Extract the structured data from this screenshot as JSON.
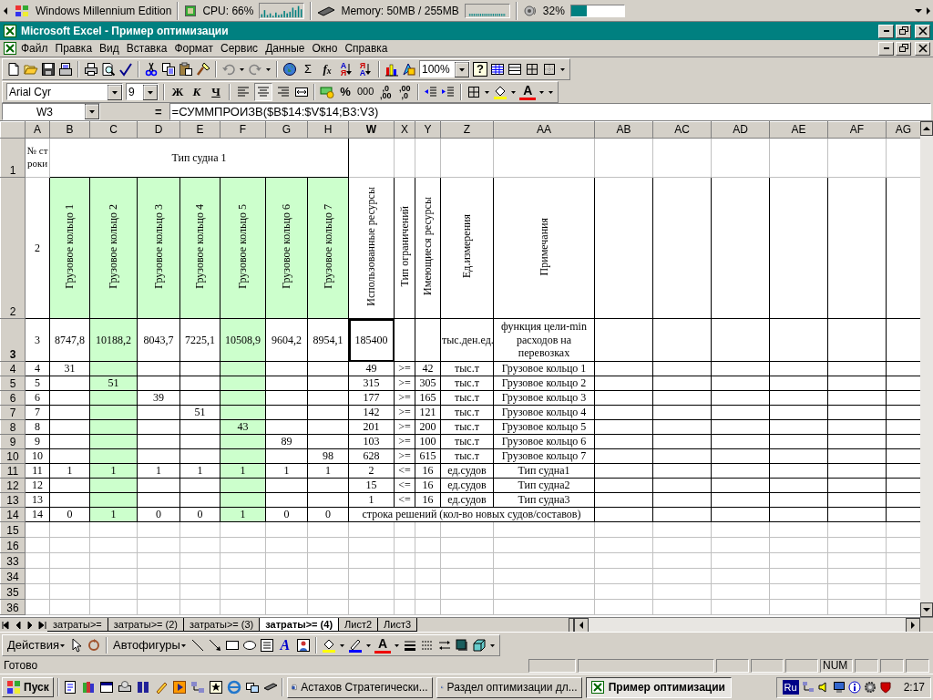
{
  "system_bar": {
    "os_label": "Windows Millennium Edition",
    "cpu": "CPU: 66%",
    "memory": "Memory: 50MB / 255MB",
    "volume": {
      "reading": "32%",
      "level": 0.3
    }
  },
  "window": {
    "title": "Microsoft Excel - Пример оптимизации"
  },
  "menu": [
    "Файл",
    "Правка",
    "Вид",
    "Вставка",
    "Формат",
    "Сервис",
    "Данные",
    "Окно",
    "Справка"
  ],
  "standard_toolbar": {
    "sum": "Σ",
    "function": "f$_{x}$",
    "sort_ascending": [
      "А",
      "Я"
    ],
    "sort_descending": [
      "Я",
      "А"
    ],
    "zoom": "100%",
    "help": "?"
  },
  "formatting_toolbar": {
    "font": "Arial Cyr",
    "size": "9",
    "bold": "Ж",
    "italic": "К",
    "underline": "Ч",
    "alignment": [
      {
        "selected": false
      },
      {
        "selected": true
      },
      {
        "selected": false
      }
    ],
    "percent": "%",
    "thousands": "000",
    "increase_decimal": [
      ",0",
      ",00"
    ],
    "decrease_decimal": [
      ",00",
      ",0"
    ],
    "font_color": "A"
  },
  "formula_bar": {
    "name_box": "W3",
    "equals": "=",
    "formula": "=СУММПРОИЗВ($B$14:$V$14;B3:V3)"
  },
  "columns": [
    {
      "label": "A",
      "selected": false
    },
    {
      "label": "B",
      "selected": false
    },
    {
      "label": "C",
      "selected": false
    },
    {
      "label": "D",
      "selected": false
    },
    {
      "label": "E",
      "selected": false
    },
    {
      "label": "F",
      "selected": false
    },
    {
      "label": "G",
      "selected": false
    },
    {
      "label": "H",
      "selected": false
    },
    {
      "label": "W",
      "selected": true
    },
    {
      "label": "X",
      "selected": false
    },
    {
      "label": "Y",
      "selected": false
    },
    {
      "label": "Z",
      "selected": false
    },
    {
      "label": "AA",
      "selected": false
    },
    {
      "label": "AB",
      "selected": false
    },
    {
      "label": "AC",
      "selected": false
    },
    {
      "label": "AD",
      "selected": false
    },
    {
      "label": "AE",
      "selected": false
    },
    {
      "label": "AF",
      "selected": false
    },
    {
      "label": "AG",
      "selected": false
    }
  ],
  "rows": [
    {
      "label": "1",
      "selected": false,
      "boxed": false,
      "cells": [
        {
          "text": "№ строки"
        },
        {
          "text": "Тип судна 1"
        },
        {
          "kind": "continued"
        },
        {
          "kind": "continued"
        },
        {
          "kind": "continued"
        },
        {
          "kind": "continued"
        },
        {
          "kind": "continued"
        },
        {
          "kind": "continued"
        }
      ]
    },
    {
      "label": "2",
      "selected": false,
      "boxed": true,
      "cells": [
        {
          "text": "2"
        },
        {
          "text": "Грузовое кольцо 1",
          "kind": "vertical",
          "color": "#ccffcc"
        },
        {
          "text": "Грузовое кольцо 2",
          "kind": "vertical",
          "color": "#ccffcc"
        },
        {
          "text": "Грузовое кольцо 3",
          "kind": "vertical",
          "color": "#ccffcc"
        },
        {
          "text": "Грузовое кольцо 4",
          "kind": "vertical",
          "color": "#ccffcc"
        },
        {
          "text": "Грузовое кольцо 5",
          "kind": "vertical",
          "color": "#ccffcc"
        },
        {
          "text": "Грузовое кольцо 6",
          "kind": "vertical",
          "color": "#ccffcc"
        },
        {
          "text": "Грузовое кольцо 7",
          "kind": "vertical",
          "color": "#ccffcc"
        },
        {
          "text": "Использованные ресурсы",
          "kind": "vertical"
        },
        {
          "text": "Тип ограничений",
          "kind": "vertical"
        },
        {
          "text": "Имеющиеся ресурсы",
          "kind": "vertical"
        },
        {
          "text": "Ед.измерения",
          "kind": "vertical"
        },
        {
          "text": "Примечания",
          "kind": "vertical"
        }
      ]
    },
    {
      "label": "3",
      "selected": true,
      "boxed": true,
      "cells": [
        {
          "text": "3"
        },
        {
          "text": "8747,8"
        },
        {
          "text": "10188,2",
          "color": "#ccffcc"
        },
        {
          "text": "8043,7"
        },
        {
          "text": "7225,1"
        },
        {
          "text": "10508,9",
          "color": "#ccffcc"
        },
        {
          "text": "9604,2"
        },
        {
          "text": "8954,1"
        },
        {
          "text": "185400"
        },
        null,
        null,
        {
          "text": "тыс.ден.ед."
        },
        {
          "text": "функция цели-min расходов на перевозках"
        }
      ]
    },
    {
      "label": "4",
      "selected": false,
      "boxed": true,
      "cells": [
        {
          "text": "4"
        },
        {
          "text": "31"
        },
        {
          "color": "#ccffcc"
        },
        null,
        null,
        {
          "color": "#ccffcc"
        },
        null,
        null,
        {
          "text": "49"
        },
        {
          "text": ">="
        },
        {
          "text": "42"
        },
        {
          "text": "тыс.т"
        },
        {
          "text": "Грузовое кольцо 1"
        }
      ]
    },
    {
      "label": "5",
      "selected": false,
      "boxed": true,
      "cells": [
        {
          "text": "5"
        },
        null,
        {
          "text": "51",
          "color": "#ccffcc"
        },
        null,
        null,
        {
          "color": "#ccffcc"
        },
        null,
        null,
        {
          "text": "315"
        },
        {
          "text": ">="
        },
        {
          "text": "305"
        },
        {
          "text": "тыс.т"
        },
        {
          "text": "Грузовое кольцо 2"
        }
      ]
    },
    {
      "label": "6",
      "selected": false,
      "boxed": true,
      "cells": [
        {
          "text": "6"
        },
        null,
        {
          "color": "#ccffcc"
        },
        {
          "text": "39"
        },
        null,
        {
          "color": "#ccffcc"
        },
        null,
        null,
        {
          "text": "177"
        },
        {
          "text": ">="
        },
        {
          "text": "165"
        },
        {
          "text": "тыс.т"
        },
        {
          "text": "Грузовое кольцо 3"
        }
      ]
    },
    {
      "label": "7",
      "selected": false,
      "boxed": true,
      "cells": [
        {
          "text": "7"
        },
        null,
        {
          "color": "#ccffcc"
        },
        null,
        {
          "text": "51"
        },
        {
          "color": "#ccffcc"
        },
        null,
        null,
        {
          "text": "142"
        },
        {
          "text": ">="
        },
        {
          "text": "121"
        },
        {
          "text": "тыс.т"
        },
        {
          "text": "Грузовое кольцо 4"
        }
      ]
    },
    {
      "label": "8",
      "selected": false,
      "boxed": true,
      "cells": [
        {
          "text": "8"
        },
        null,
        {
          "color": "#ccffcc"
        },
        null,
        null,
        {
          "text": "43",
          "color": "#ccffcc"
        },
        null,
        null,
        {
          "text": "201"
        },
        {
          "text": ">="
        },
        {
          "text": "200"
        },
        {
          "text": "тыс.т"
        },
        {
          "text": "Грузовое кольцо 5"
        }
      ]
    },
    {
      "label": "9",
      "selected": false,
      "boxed": true,
      "cells": [
        {
          "text": "9"
        },
        null,
        {
          "color": "#ccffcc"
        },
        null,
        null,
        {
          "color": "#ccffcc"
        },
        {
          "text": "89"
        },
        null,
        {
          "text": "103"
        },
        {
          "text": ">="
        },
        {
          "text": "100"
        },
        {
          "text": "тыс.т"
        },
        {
          "text": "Грузовое кольцо 6"
        }
      ]
    },
    {
      "label": "10",
      "selected": false,
      "boxed": true,
      "cells": [
        {
          "text": "10"
        },
        null,
        {
          "color": "#ccffcc"
        },
        null,
        null,
        {
          "color": "#ccffcc"
        },
        null,
        {
          "text": "98"
        },
        {
          "text": "628"
        },
        {
          "text": ">="
        },
        {
          "text": "615"
        },
        {
          "text": "тыс.т"
        },
        {
          "text": "Грузовое кольцо 7"
        }
      ]
    },
    {
      "label": "11",
      "selected": false,
      "boxed": true,
      "cells": [
        {
          "text": "11"
        },
        {
          "text": "1"
        },
        {
          "text": "1",
          "color": "#ccffcc"
        },
        {
          "text": "1"
        },
        {
          "text": "1"
        },
        {
          "text": "1",
          "color": "#ccffcc"
        },
        {
          "text": "1"
        },
        {
          "text": "1"
        },
        {
          "text": "2"
        },
        {
          "text": "<="
        },
        {
          "text": "16"
        },
        {
          "text": "ед.судов"
        },
        {
          "text": "Тип судна1"
        }
      ]
    },
    {
      "label": "12",
      "selected": false,
      "boxed": true,
      "cells": [
        {
          "text": "12"
        },
        null,
        {
          "color": "#ccffcc"
        },
        null,
        null,
        {
          "color": "#ccffcc"
        },
        null,
        null,
        {
          "text": "15"
        },
        {
          "text": "<="
        },
        {
          "text": "16"
        },
        {
          "text": "ед.судов"
        },
        {
          "text": "Тип судна2"
        }
      ]
    },
    {
      "label": "13",
      "selected": false,
      "boxed": true,
      "cells": [
        {
          "text": "13"
        },
        null,
        {
          "color": "#ccffcc"
        },
        null,
        null,
        {
          "color": "#ccffcc"
        },
        null,
        null,
        {
          "text": "1"
        },
        {
          "text": "<="
        },
        {
          "text": "16"
        },
        {
          "text": "ед.судов"
        },
        {
          "text": "Тип судна3"
        }
      ]
    },
    {
      "label": "14",
      "selected": false,
      "boxed": true,
      "cells": [
        {
          "text": "14"
        },
        {
          "text": "0"
        },
        {
          "text": "1",
          "color": "#ccffcc"
        },
        {
          "text": "0"
        },
        {
          "text": "0"
        },
        {
          "text": "1",
          "color": "#ccffcc"
        },
        {
          "text": "0"
        },
        {
          "text": "0"
        },
        {
          "text": "строка решений (кол-во новых судов/составов)"
        },
        {
          "kind": "continued"
        },
        {
          "kind": "continued"
        },
        {
          "kind": "continued"
        },
        {
          "kind": "continued"
        }
      ]
    },
    {
      "label": "15",
      "selected": false,
      "boxed": false
    },
    {
      "label": "16",
      "selected": false,
      "boxed": false
    },
    {
      "label": "33",
      "selected": false,
      "boxed": false
    },
    {
      "label": "34",
      "selected": false,
      "boxed": false
    },
    {
      "label": "35",
      "selected": false,
      "boxed": false
    },
    {
      "label": "36",
      "selected": false,
      "boxed": false
    }
  ],
  "sheet_tabs": [
    {
      "label": "затраты>=",
      "selected": false
    },
    {
      "label": "затраты>= (2)",
      "selected": false
    },
    {
      "label": "затраты>= (3)",
      "selected": false
    },
    {
      "label": "затраты>= (4)",
      "selected": true
    },
    {
      "label": "Лист2",
      "selected": false
    },
    {
      "label": "Лист3",
      "selected": false
    }
  ],
  "drawing_toolbar": {
    "actions": "Действия",
    "autoshapes": "Автофигуры",
    "wordart": "A",
    "font_color": "A"
  },
  "status_bar": {
    "text": "Готово",
    "num": "NUM"
  },
  "taskbar": {
    "start": "Пуск",
    "tasks": [
      {
        "label": "Астахов Стратегически...",
        "selected": false
      },
      {
        "label": "Раздел оптимизации дл...",
        "selected": false
      },
      {
        "label": "Пример оптимизации",
        "selected": true
      }
    ],
    "language": "Ru",
    "clock": "2:17"
  }
}
